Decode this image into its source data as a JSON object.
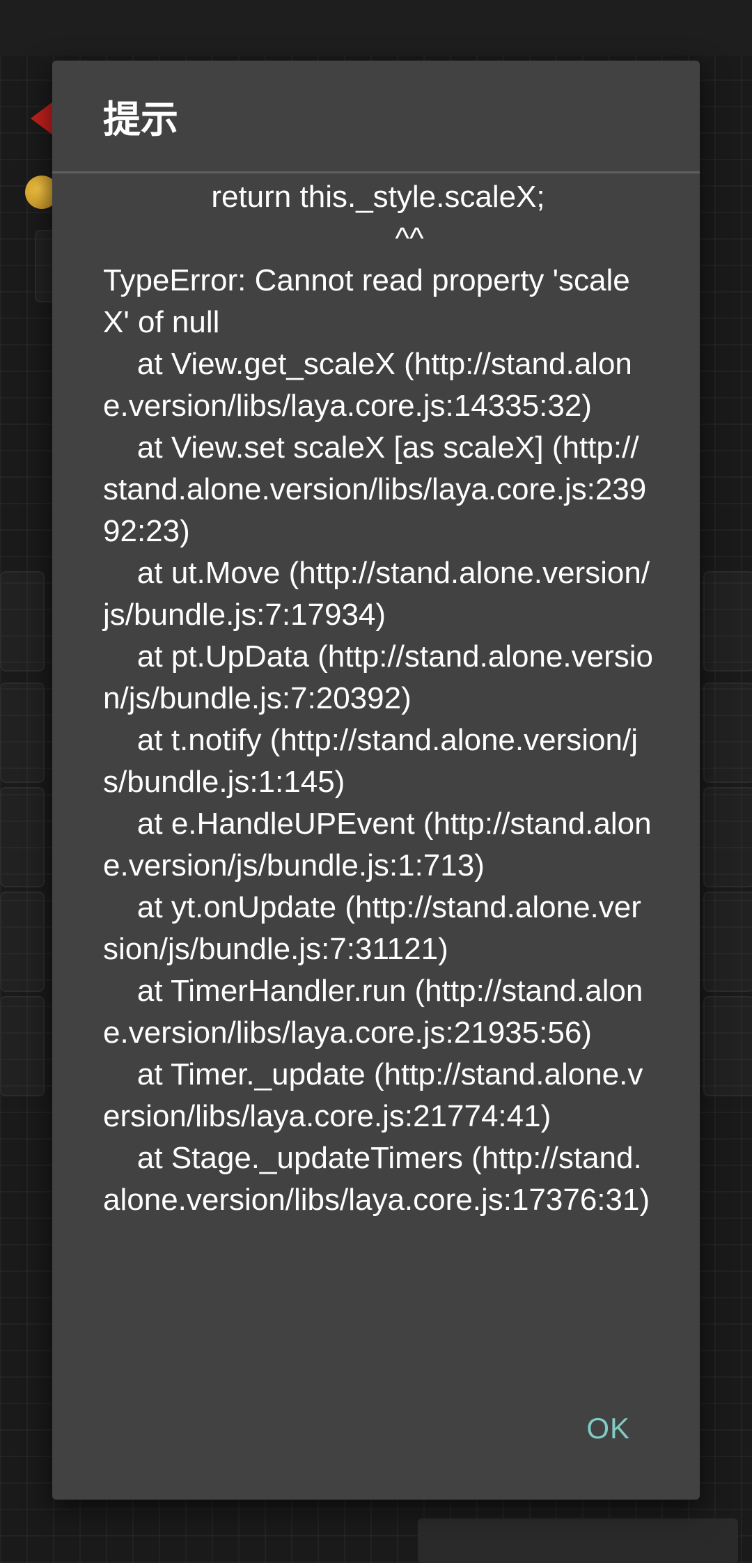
{
  "dialog": {
    "title": "提示",
    "message": {
      "code_line": "return this._style.scaleX;",
      "caret": "^^",
      "stack": "TypeError: Cannot read property 'scaleX' of null\n    at View.get_scaleX (http://stand.alone.version/libs/laya.core.js:14335:32)\n    at View.set scaleX [as scaleX] (http://stand.alone.version/libs/laya.core.js:23992:23)\n    at ut.Move (http://stand.alone.version/js/bundle.js:7:17934)\n    at pt.UpData (http://stand.alone.version/js/bundle.js:7:20392)\n    at t.notify (http://stand.alone.version/js/bundle.js:1:145)\n    at e.HandleUPEvent (http://stand.alone.version/js/bundle.js:1:713)\n    at yt.onUpdate (http://stand.alone.version/js/bundle.js:7:31121)\n    at TimerHandler.run (http://stand.alone.version/libs/laya.core.js:21935:56)\n    at Timer._update (http://stand.alone.version/libs/laya.core.js:21774:41)\n    at Stage._updateTimers (http://stand.alone.version/libs/laya.core.js:17376:31)"
    },
    "ok_label": "OK"
  },
  "colors": {
    "dialog_bg": "#424242",
    "accent": "#80cbc4",
    "text": "#ffffff"
  }
}
